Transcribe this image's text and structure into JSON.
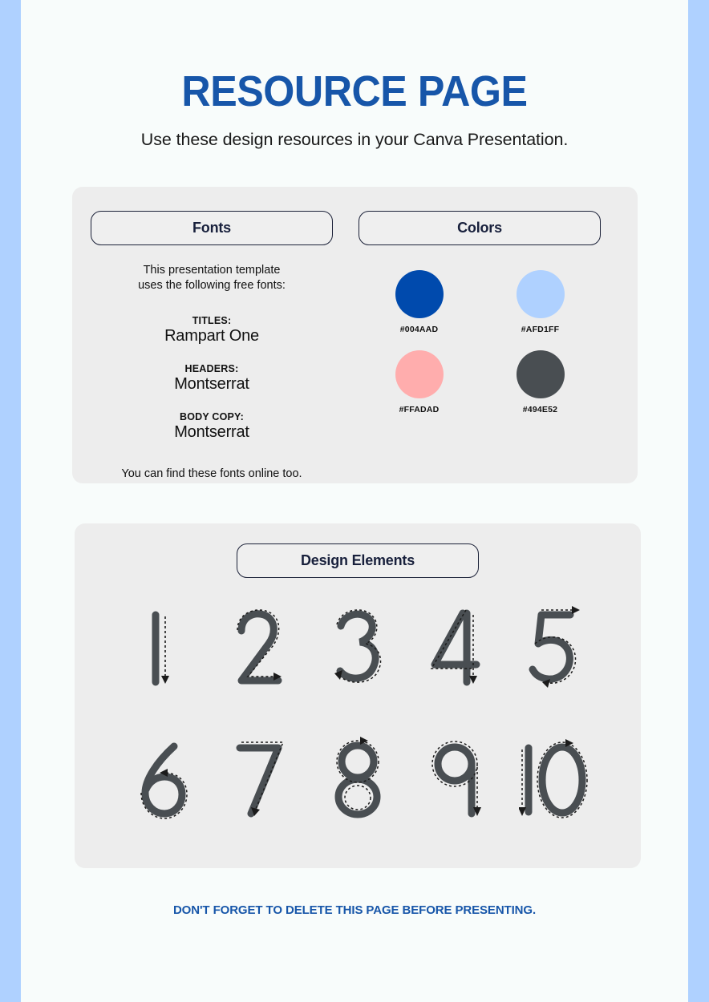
{
  "page": {
    "title": "RESOURCE PAGE",
    "subtitle": "Use these design resources in your Canva Presentation.",
    "footer_note": "DON'T FORGET TO DELETE THIS PAGE BEFORE PRESENTING.",
    "background_color": "#F8FCFB",
    "card_color": "#EDEDED",
    "edge_bar_color": "#AFD1FF",
    "accent_color": "#1756A9"
  },
  "fonts": {
    "heading": "Fonts",
    "intro_line_1": "This presentation template",
    "intro_line_2": "uses the following free fonts:",
    "groups": [
      {
        "role": "TITLES:",
        "name": "Rampart One"
      },
      {
        "role": "HEADERS:",
        "name": "Montserrat"
      },
      {
        "role": "BODY COPY:",
        "name": "Montserrat"
      }
    ],
    "outro": "You can find these fonts online too."
  },
  "colors": {
    "heading": "Colors",
    "swatches": [
      {
        "hex_label": "#004AAD",
        "hex": "#004AAD"
      },
      {
        "hex_label": "#AFD1FF",
        "hex": "#AFD1FF"
      },
      {
        "hex_label": "#FFADAD",
        "hex": "#FFADAD"
      },
      {
        "hex_label": "#494E52",
        "hex": "#494E52"
      }
    ]
  },
  "design_elements": {
    "heading": "Design Elements",
    "stroke_color": "#494E52",
    "row_1": [
      "1",
      "2",
      "3",
      "4",
      "5"
    ],
    "row_2": [
      "6",
      "7",
      "8",
      "9",
      "10"
    ]
  }
}
